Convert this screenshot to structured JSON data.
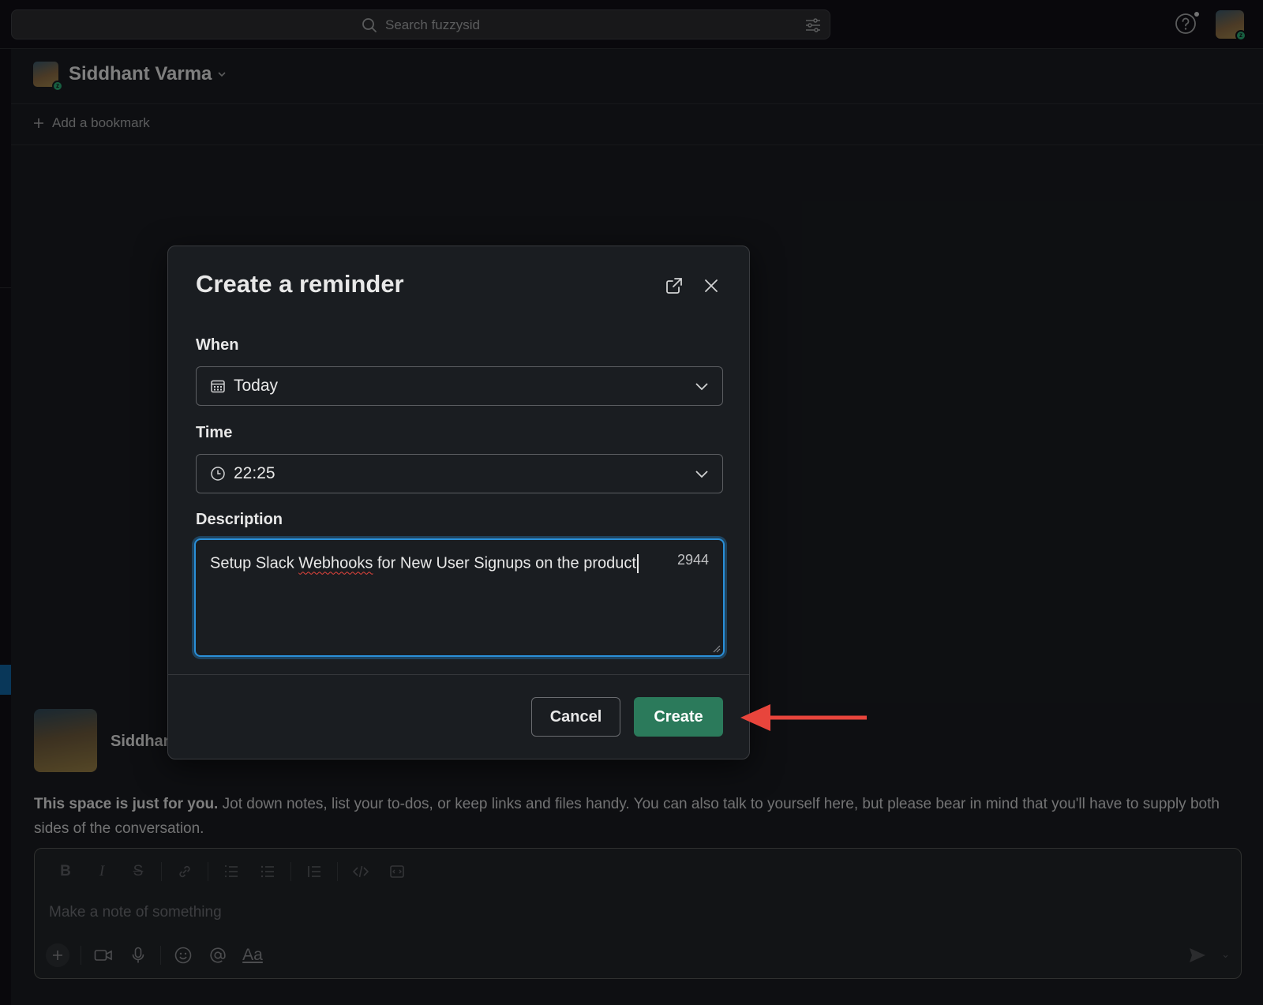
{
  "search": {
    "placeholder": "Search fuzzysid"
  },
  "channel": {
    "name": "Siddhant Varma",
    "bookmark_label": "Add a bookmark"
  },
  "message": {
    "author_partial": "Siddhan",
    "intro_bold": "This space is just for you.",
    "intro_text": " Jot down notes, list your to-dos, or keep links and files handy. You can also talk to yourself here, but please bear in mind that you'll have to supply both sides of the conversation."
  },
  "composer": {
    "placeholder": "Make a note of something",
    "format_tools": [
      "B",
      "I",
      "S"
    ],
    "text_style_label": "Aa"
  },
  "modal": {
    "title": "Create a reminder",
    "when_label": "When",
    "when_value": "Today",
    "time_label": "Time",
    "time_value": "22:25",
    "description_label": "Description",
    "description_before": "Setup Slack ",
    "description_misspelled": "Webhooks",
    "description_after": " for New User Signups on the product",
    "char_count": "2944",
    "cancel_label": "Cancel",
    "create_label": "Create"
  },
  "colors": {
    "accent_green": "#2b7a5b",
    "focus_blue": "#2a8fd8",
    "annotation_red": "#e8453c",
    "presence_green": "#2bac76"
  },
  "icons": [
    "search-icon",
    "filter-icon",
    "help-icon",
    "chevron-down-icon",
    "plus-icon",
    "calendar-icon",
    "clock-icon",
    "external-link-icon",
    "close-icon",
    "send-icon",
    "video-icon",
    "microphone-icon",
    "emoji-icon",
    "mention-icon"
  ]
}
